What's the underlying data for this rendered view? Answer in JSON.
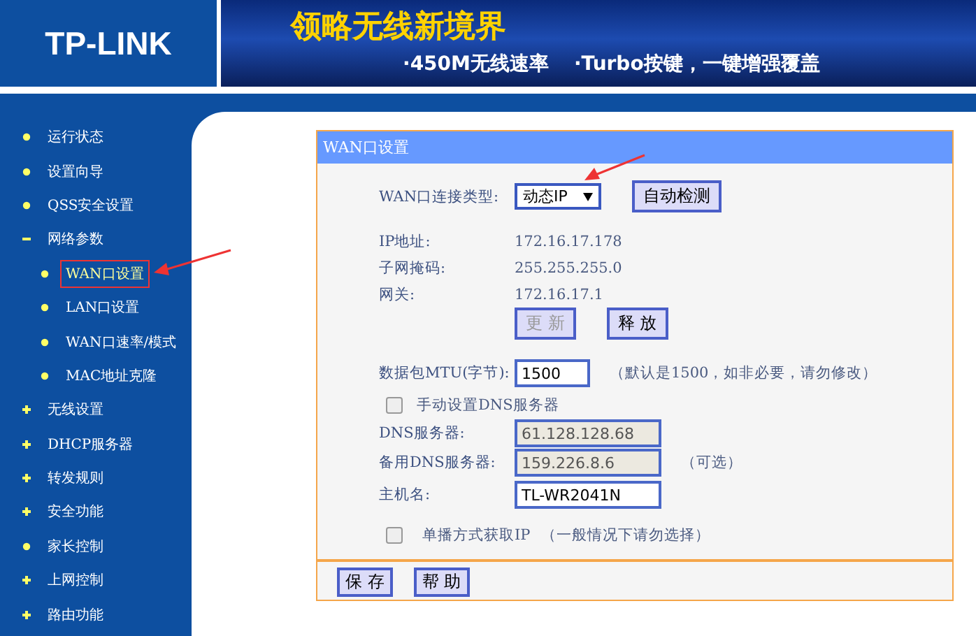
{
  "header": {
    "logo": "TP-LINK",
    "slogan": "领略无线新境界",
    "features": [
      "·450M无线速率",
      "·Turbo按键，一键增强覆盖"
    ]
  },
  "sidebar": {
    "items": [
      {
        "label": "运行状态",
        "kind": "leaf",
        "selected": false
      },
      {
        "label": "设置向导",
        "kind": "leaf",
        "selected": false
      },
      {
        "label": "QSS安全设置",
        "kind": "leaf",
        "selected": false
      },
      {
        "label": "网络参数",
        "kind": "expanded",
        "selected": false,
        "children": [
          {
            "label": "WAN口设置",
            "kind": "leaf",
            "selected": true
          },
          {
            "label": "LAN口设置",
            "kind": "leaf",
            "selected": false
          },
          {
            "label": "WAN口速率/模式",
            "kind": "leaf",
            "selected": false
          },
          {
            "label": "MAC地址克隆",
            "kind": "leaf",
            "selected": false
          }
        ]
      },
      {
        "label": "无线设置",
        "kind": "collapsed",
        "selected": false
      },
      {
        "label": "DHCP服务器",
        "kind": "collapsed",
        "selected": false
      },
      {
        "label": "转发规则",
        "kind": "collapsed",
        "selected": false
      },
      {
        "label": "安全功能",
        "kind": "collapsed",
        "selected": false
      },
      {
        "label": "家长控制",
        "kind": "leaf",
        "selected": false
      },
      {
        "label": "上网控制",
        "kind": "collapsed",
        "selected": false
      },
      {
        "label": "路由功能",
        "kind": "collapsed",
        "selected": false
      }
    ]
  },
  "panel": {
    "title": "WAN口设置",
    "connection_type": {
      "label": "WAN口连接类型:",
      "value": "动态IP",
      "button": "自动检测"
    },
    "info": [
      {
        "label": "IP地址:",
        "value": "172.16.17.178"
      },
      {
        "label": "子网掩码:",
        "value": "255.255.255.0"
      },
      {
        "label": "网关:",
        "value": "172.16.17.1"
      }
    ],
    "actions": [
      {
        "label": "更 新",
        "disabled": true
      },
      {
        "label": "释 放",
        "disabled": false
      }
    ],
    "mtu": {
      "label": "数据包MTU(字节):",
      "value": "1500",
      "hint": "（默认是1500，如非必要，请勿修改）"
    },
    "manual_dns": {
      "label": "手动设置DNS服务器",
      "checked": false
    },
    "dns": [
      {
        "label": "DNS服务器:",
        "value": "61.128.128.68",
        "disabled": true
      },
      {
        "label": "备用DNS服务器:",
        "value": "159.226.8.6",
        "disabled": true,
        "note": "（可选）"
      }
    ],
    "hostname": {
      "label": "主机名:",
      "value": "TL-WR2041N"
    },
    "unicast": {
      "label": "单播方式获取IP",
      "hint": "（一般情况下请勿选择）",
      "checked": false
    },
    "footer": [
      "保 存",
      "帮 助"
    ]
  }
}
